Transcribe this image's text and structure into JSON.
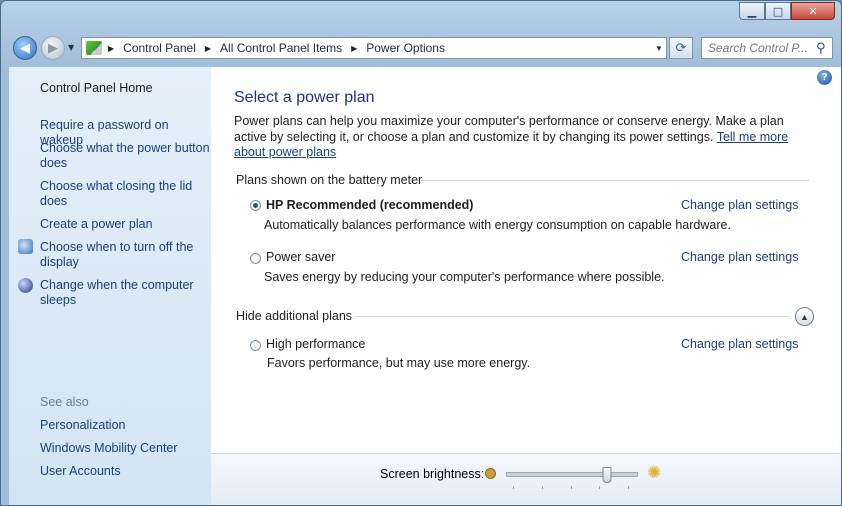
{
  "window": {
    "minimize_glyph": "▁",
    "maximize_glyph": "□",
    "close_glyph": "✕"
  },
  "nav": {
    "back_glyph": "◀",
    "forward_glyph": "▶",
    "breadcrumb": [
      "Control Panel",
      "All Control Panel Items",
      "Power Options"
    ],
    "search_placeholder": "Search Control P..."
  },
  "sidebar": {
    "home": "Control Panel Home",
    "links": [
      "Require a password on wakeup",
      "Choose what the power button does",
      "Choose what closing the lid does",
      "Create a power plan",
      "Choose when to turn off the display",
      "Change when the computer sleeps"
    ],
    "see_also_label": "See also",
    "see_also": [
      "Personalization",
      "Windows Mobility Center",
      "User Accounts"
    ]
  },
  "main": {
    "title": "Select a power plan",
    "intro": "Power plans can help you maximize your computer's performance or conserve energy. Make a plan active by selecting it, or choose a plan and customize it by changing its power settings. ",
    "intro_link": "Tell me more about power plans",
    "battery_section": "Plans shown on the battery meter",
    "additional_section": "Hide additional plans",
    "change_label": "Change plan settings",
    "plans": [
      {
        "name": "HP Recommended (recommended)",
        "desc": "Automatically balances performance with energy consumption on capable hardware.",
        "selected": true
      },
      {
        "name": "Power saver",
        "desc": "Saves energy by reducing your computer's performance where possible.",
        "selected": false
      },
      {
        "name": "High performance",
        "desc": "Favors performance, but may use more energy.",
        "selected": false
      }
    ]
  },
  "footer": {
    "brightness_label": "Screen brightness:",
    "brightness_fraction": 0.77
  },
  "colors": {
    "link": "#1a3f7a",
    "title": "#1e3287"
  }
}
